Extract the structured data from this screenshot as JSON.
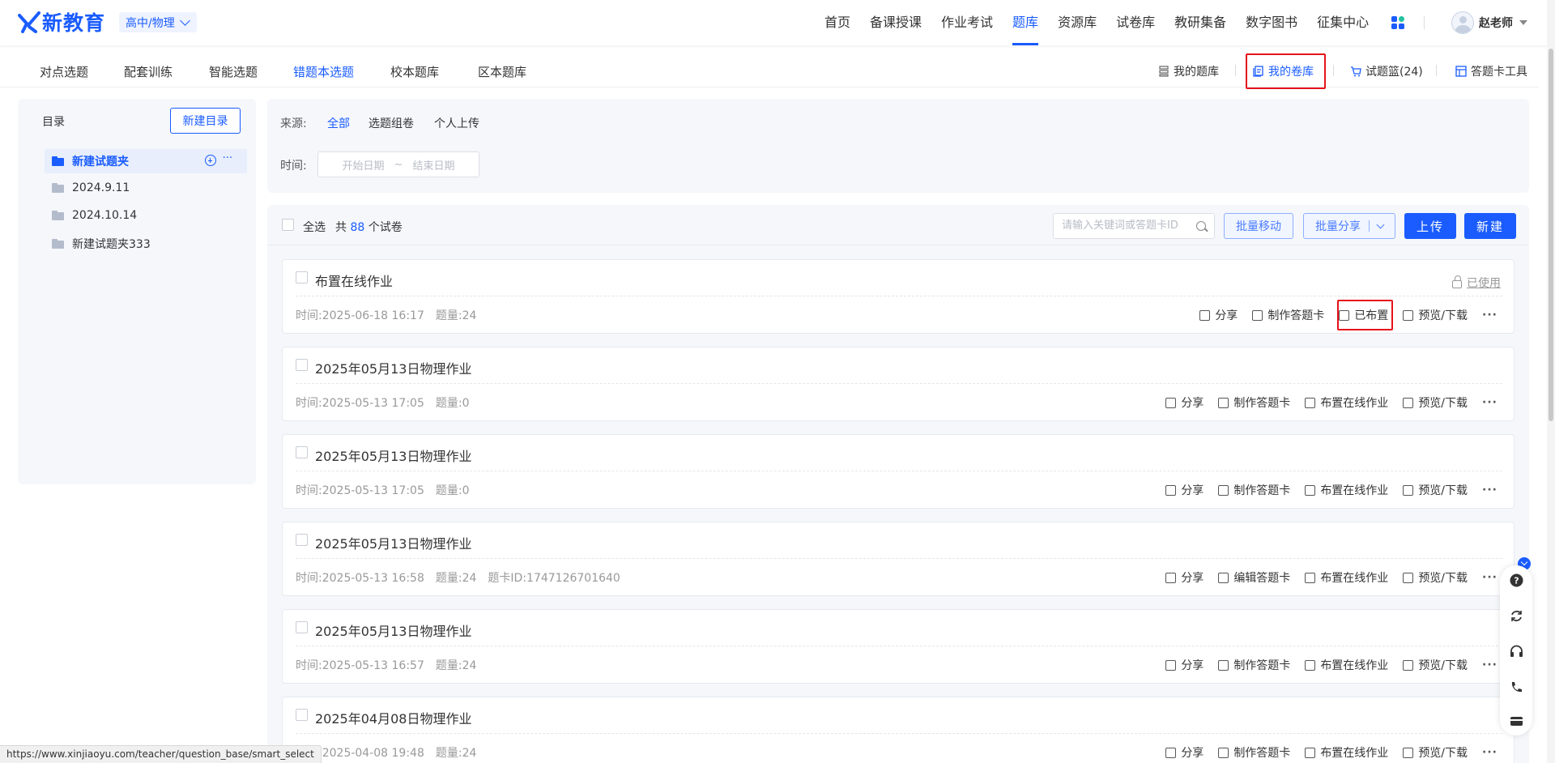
{
  "brand": {
    "logo_text": "新教育",
    "accent": "#1a5cff"
  },
  "header": {
    "grade_subject": "高中/物理",
    "nav": [
      "首页",
      "备课授课",
      "作业考试",
      "题库",
      "资源库",
      "试卷库",
      "教研集备",
      "数字图书",
      "征集中心"
    ],
    "active_nav": "题库",
    "user_name": "赵老师"
  },
  "subnav": {
    "tabs": [
      "对点选题",
      "配套训练",
      "智能选题",
      "错题本选题",
      "校本题库",
      "区本题库"
    ],
    "active_tab": "错题本选题",
    "tools": {
      "my_questions": "我的题库",
      "my_papers": "我的卷库",
      "basket": "试题篮(24)",
      "answer_card_tool": "答题卡工具"
    }
  },
  "sidebar": {
    "title": "目录",
    "new_button": "新建目录",
    "folders": [
      "新建试题夹",
      "2024.9.11",
      "2024.10.14",
      "新建试题夹333"
    ],
    "more": "···"
  },
  "filter": {
    "source_label": "来源:",
    "source_options": [
      "全部",
      "选题组卷",
      "个人上传"
    ],
    "time_label": "时间:",
    "start_placeholder": "开始日期",
    "range_sep": "~",
    "end_placeholder": "结束日期"
  },
  "list_header": {
    "select_all": "全选",
    "total_prefix": "共",
    "total_count": "88",
    "total_suffix": "个试卷",
    "search_placeholder": "请输入关键词或答题卡ID",
    "batch_move": "批量移动",
    "batch_share": "批量分享",
    "upload": "上传",
    "create": "新建"
  },
  "papers": [
    {
      "title": "布置在线作业",
      "time": "时间:2025-06-18 16:17",
      "count": "题量:24",
      "card_id": "",
      "badge": "已使用",
      "actions": [
        "分享",
        "制作答题卡",
        "已布置",
        "预览/下载"
      ]
    },
    {
      "title": "2025年05月13日物理作业",
      "time": "时间:2025-05-13 17:05",
      "count": "题量:0",
      "card_id": "",
      "badge": "",
      "actions": [
        "分享",
        "制作答题卡",
        "布置在线作业",
        "预览/下载"
      ]
    },
    {
      "title": "2025年05月13日物理作业",
      "time": "时间:2025-05-13 17:05",
      "count": "题量:0",
      "card_id": "",
      "badge": "",
      "actions": [
        "分享",
        "制作答题卡",
        "布置在线作业",
        "预览/下载"
      ]
    },
    {
      "title": "2025年05月13日物理作业",
      "time": "时间:2025-05-13 16:58",
      "count": "题量:24",
      "card_id": "题卡ID:1747126701640",
      "badge": "",
      "actions": [
        "分享",
        "编辑答题卡",
        "布置在线作业",
        "预览/下载"
      ]
    },
    {
      "title": "2025年05月13日物理作业",
      "time": "时间:2025-05-13 16:57",
      "count": "题量:24",
      "card_id": "",
      "badge": "",
      "actions": [
        "分享",
        "制作答题卡",
        "布置在线作业",
        "预览/下载"
      ]
    },
    {
      "title": "2025年04月08日物理作业",
      "time": "时间:2025-04-08 19:48",
      "count": "题量:24",
      "card_id": "",
      "badge": "",
      "actions": [
        "分享",
        "制作答题卡",
        "布置在线作业",
        "预览/下载"
      ]
    }
  ],
  "status_url": "https://www.xinjiaoyu.com/teacher/question_base/smart_select"
}
